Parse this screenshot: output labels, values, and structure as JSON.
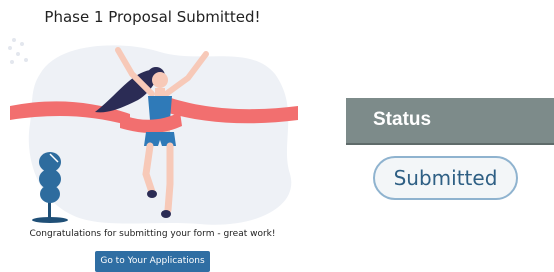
{
  "left_panel": {
    "title": "Phase 1 Proposal Submitted!",
    "congrats_text": "Congratulations for submitting your form - great work!",
    "cta_button_label": "Go to Your Applications",
    "colors": {
      "ribbon": "#f26f6f",
      "blob": "#eef1f6",
      "hair": "#2b2c55",
      "top": "#2f7ab8",
      "tree": "#2e6c9e",
      "button": "#2f6ea3"
    }
  },
  "status": {
    "header_label": "Status",
    "value": "Submitted",
    "colors": {
      "header_bg": "#7d8b8a",
      "pill_text": "#2e5f84",
      "pill_border": "#8fb3cf"
    }
  }
}
